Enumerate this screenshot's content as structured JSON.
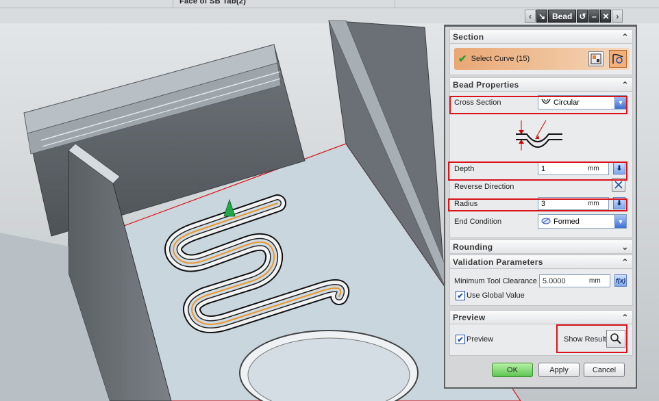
{
  "header": {
    "title": "Face of SB Tab(2)"
  },
  "dialog": {
    "title": "Bead",
    "section": {
      "title": "Section",
      "select_curve": "Select Curve (15)"
    },
    "bead_properties": {
      "title": "Bead Properties",
      "cross_section_label": "Cross Section",
      "cross_section_value": "Circular",
      "depth_label": "Depth",
      "depth_value": "1",
      "depth_unit": "mm",
      "reverse_direction_label": "Reverse Direction",
      "radius_label": "Radius",
      "radius_value": "3",
      "radius_unit": "mm",
      "end_condition_label": "End Condition",
      "end_condition_value": "Formed"
    },
    "rounding": {
      "title": "Rounding"
    },
    "validation": {
      "title": "Validation Parameters",
      "min_tool_clearance_label": "Minimum Tool Clearance",
      "min_tool_clearance_value": "5.0000",
      "min_tool_clearance_unit": "mm",
      "use_global_value_label": "Use Global Value",
      "use_global_value_checked": true
    },
    "preview": {
      "title": "Preview",
      "preview_label": "Preview",
      "preview_checked": true,
      "show_result_label": "Show Result"
    },
    "buttons": {
      "ok": "OK",
      "apply": "Apply",
      "cancel": "Cancel"
    }
  },
  "colors": {
    "highlight": "#d8131a",
    "bead_path": "#e8962e",
    "panel_bg": "#d4d6d8",
    "ok_button": "#5dc553",
    "select_row": "#e9a774"
  }
}
